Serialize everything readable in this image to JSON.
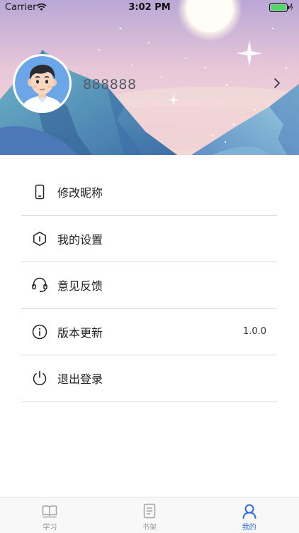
{
  "status_bar": {
    "carrier": "Carrier",
    "time": "3:02 PM"
  },
  "profile": {
    "username": "888888"
  },
  "menu": {
    "items": [
      {
        "label": "修改昵称",
        "icon": "phone-icon",
        "value": ""
      },
      {
        "label": "我的设置",
        "icon": "settings-hexagon-icon",
        "value": ""
      },
      {
        "label": "意见反馈",
        "icon": "headset-icon",
        "value": ""
      },
      {
        "label": "版本更新",
        "icon": "info-icon",
        "value": "1.0.0"
      },
      {
        "label": "退出登录",
        "icon": "power-icon",
        "value": ""
      }
    ]
  },
  "tabs": [
    {
      "label": "学习",
      "icon": "book-icon",
      "active": false
    },
    {
      "label": "书架",
      "icon": "bookshelf-icon",
      "active": false
    },
    {
      "label": "我的",
      "icon": "user-icon",
      "active": true
    }
  ],
  "colors": {
    "accent": "#2f6fde",
    "inactive_tab": "#9a9a9a",
    "divider": "#d9d9d9"
  }
}
